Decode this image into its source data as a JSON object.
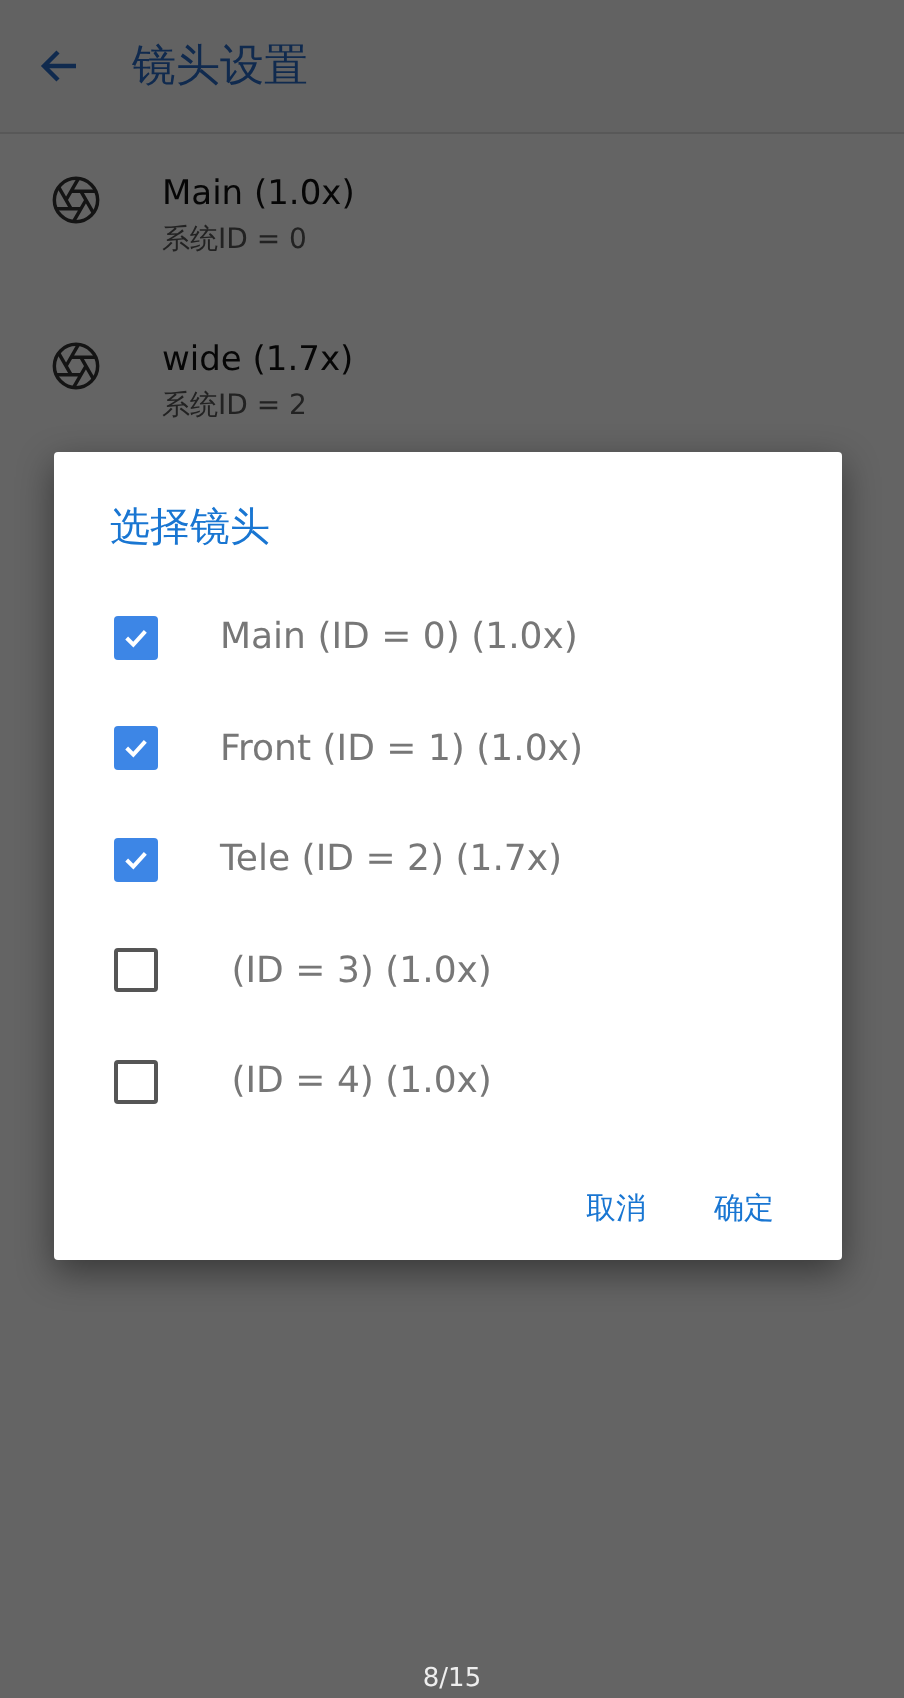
{
  "app_bar": {
    "title": "镜头设置"
  },
  "lenses": [
    {
      "title": "Main (1.0x)",
      "subtitle": "系统ID = 0"
    },
    {
      "title": "wide (1.7x)",
      "subtitle": "系统ID = 2"
    }
  ],
  "dialog": {
    "title": "选择镜头",
    "options": [
      {
        "label": "Main (ID = 0) (1.0x)",
        "checked": true
      },
      {
        "label": "Front (ID = 1) (1.0x)",
        "checked": true
      },
      {
        "label": "Tele (ID = 2) (1.7x)",
        "checked": true
      },
      {
        "label": " (ID = 3) (1.0x)",
        "checked": false
      },
      {
        "label": " (ID = 4) (1.0x)",
        "checked": false
      }
    ],
    "buttons": [
      "取消",
      "确定"
    ]
  },
  "page_counter": "8/15"
}
